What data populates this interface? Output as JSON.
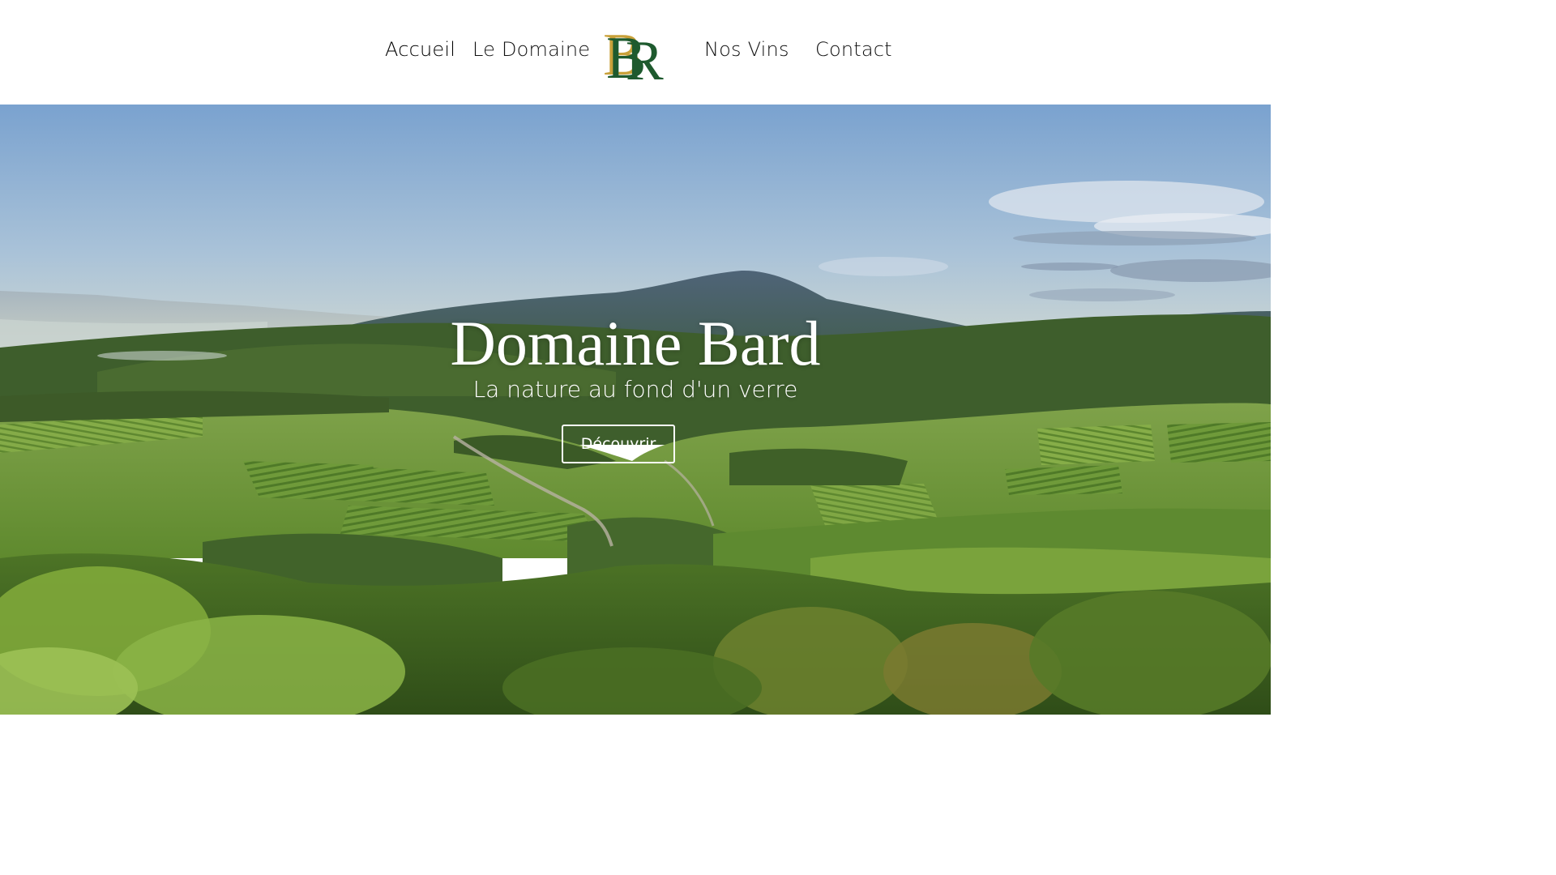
{
  "nav": {
    "items": [
      {
        "label": "Accueil",
        "active": true
      },
      {
        "label": "Le Domaine"
      },
      {
        "label": "Nos Vins"
      },
      {
        "label": "Contact"
      }
    ],
    "logo": {
      "icon": "br-monogram-logo",
      "letters": "BR"
    }
  },
  "hero": {
    "title": "Domaine Bard",
    "subtitle": "La nature au fond d'un verre",
    "button_label": "Découvrir",
    "background": "vineyard-landscape-photo"
  },
  "colors": {
    "logo_green": "#1e5a2e",
    "logo_gold": "#c9a13a",
    "sky": "#7ba3d0",
    "vineyard_green": "#6e9a3a"
  }
}
